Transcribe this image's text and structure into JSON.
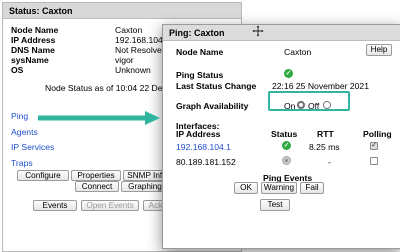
{
  "back_window": {
    "title": "Status: Caxton",
    "fields": [
      {
        "label": "Node Name",
        "value": "Caxton"
      },
      {
        "label": "IP Address",
        "value": "192.168.104.1"
      },
      {
        "label": "DNS Name",
        "value": "Not Resolved"
      },
      {
        "label": "sysName",
        "value": "vigor"
      },
      {
        "label": "OS",
        "value": "Unknown"
      }
    ],
    "status_line": "Node Status as of 10:04 22 December",
    "links": [
      "Ping",
      "Agents",
      "IP Services",
      "Traps"
    ],
    "buttons": {
      "configure": "Configure",
      "properties": "Properties",
      "snmp_info": "SNMP Info",
      "cut": "C",
      "connect": "Connect",
      "graphing": "Graphing",
      "events": "Events",
      "open_events": "Open Events",
      "acknowledge": "Acknow"
    }
  },
  "front_window": {
    "title": "Ping: Caxton",
    "node_name_label": "Node Name",
    "node_name_value": "Caxton",
    "help_label": "Help",
    "ping_status_label": "Ping Status",
    "last_status_change_label": "Last Status Change",
    "last_status_change_value": "22:16 25 November 2021",
    "graph_availability_label": "Graph Availability",
    "graph_on_label": "On",
    "graph_off_label": "Off",
    "graph_selected": "Off",
    "interfaces_label": "Interfaces:",
    "table_headers": [
      "IP Address",
      "Status",
      "RTT",
      "Polling"
    ],
    "interfaces": [
      {
        "ip": "192.168.104.1",
        "status": "ok",
        "rtt": "8.25 ms",
        "polling": true
      },
      {
        "ip": "80.189.181.152",
        "status": "unknown",
        "rtt": "-",
        "polling": false
      }
    ],
    "ping_events_label": "Ping Events",
    "ok_label": "OK",
    "warning_label": "Warning",
    "fail_label": "Fail",
    "test_label": "Test"
  },
  "colors": {
    "accent": "#2fb5a0",
    "link": "#1f4fd0",
    "ok_green": "#2eaa3e"
  },
  "icons": [
    "move-cursor-icon",
    "status-ok-icon",
    "status-unknown-icon",
    "checkbox-icon",
    "arrow-icon"
  ]
}
